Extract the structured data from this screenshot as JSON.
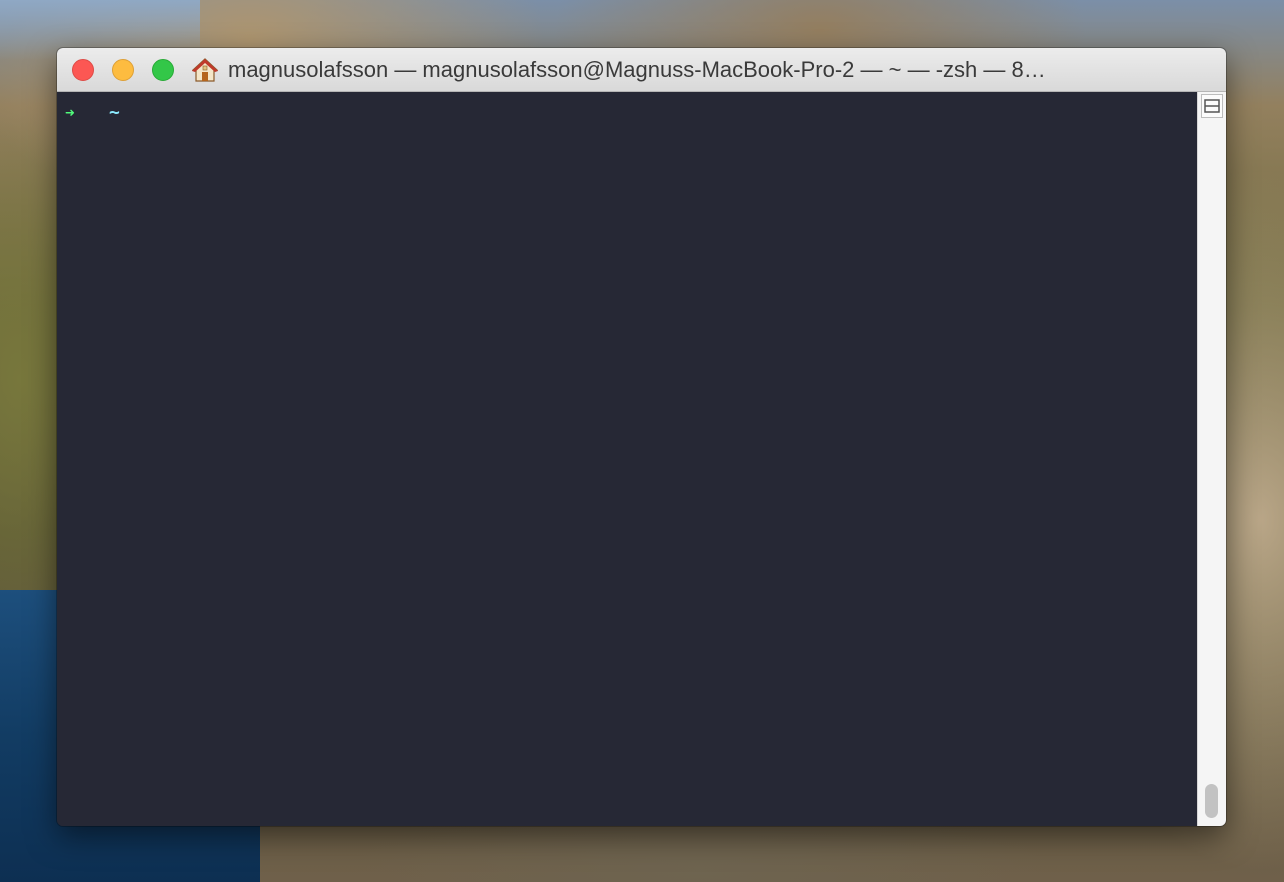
{
  "window": {
    "title": "magnusolafsson — magnusolafsson@Magnuss-MacBook-Pro-2 — ~ — -zsh — 8…",
    "title_icon": "home-icon",
    "buttons": {
      "close": "close-button",
      "minimize": "minimize-button",
      "zoom": "zoom-button"
    }
  },
  "terminal": {
    "prompt_arrow": "➜",
    "prompt_dir": "~",
    "colors": {
      "background": "#262835",
      "arrow": "#50fa7b",
      "directory": "#8be9fd"
    }
  },
  "scrollbar": {
    "split_icon": "split-pane-icon"
  }
}
